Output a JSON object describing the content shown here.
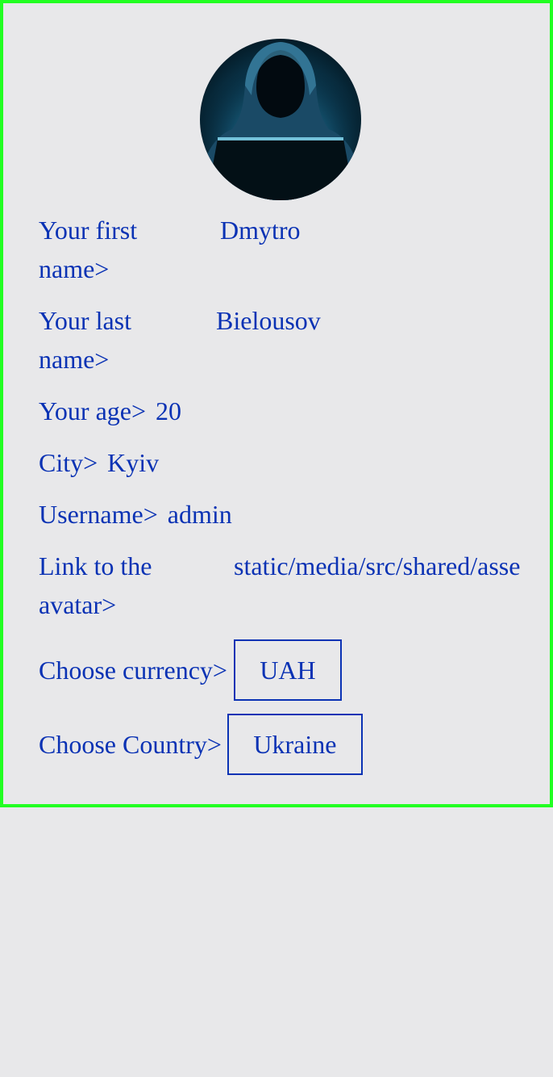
{
  "profile": {
    "avatar_icon": "hooded-hacker-avatar",
    "fields": {
      "first_name": {
        "label": "Your first name>",
        "value": "Dmytro"
      },
      "last_name": {
        "label": "Your last name>",
        "value": "Bielousov"
      },
      "age": {
        "label": "Your age>",
        "value": "20"
      },
      "city": {
        "label": "City>",
        "value": "Kyiv"
      },
      "username": {
        "label": "Username>",
        "value": "admin"
      },
      "avatar_link": {
        "label": "Link to the avatar>",
        "value": "static/media/src/shared/asse"
      }
    },
    "currency": {
      "label": "Choose currency>",
      "selected": "UAH"
    },
    "country": {
      "label": "Choose Country>",
      "selected": "Ukraine"
    }
  },
  "colors": {
    "text": "#0a32b4",
    "panel_border": "#22ff22",
    "background": "#e8e8ea"
  }
}
